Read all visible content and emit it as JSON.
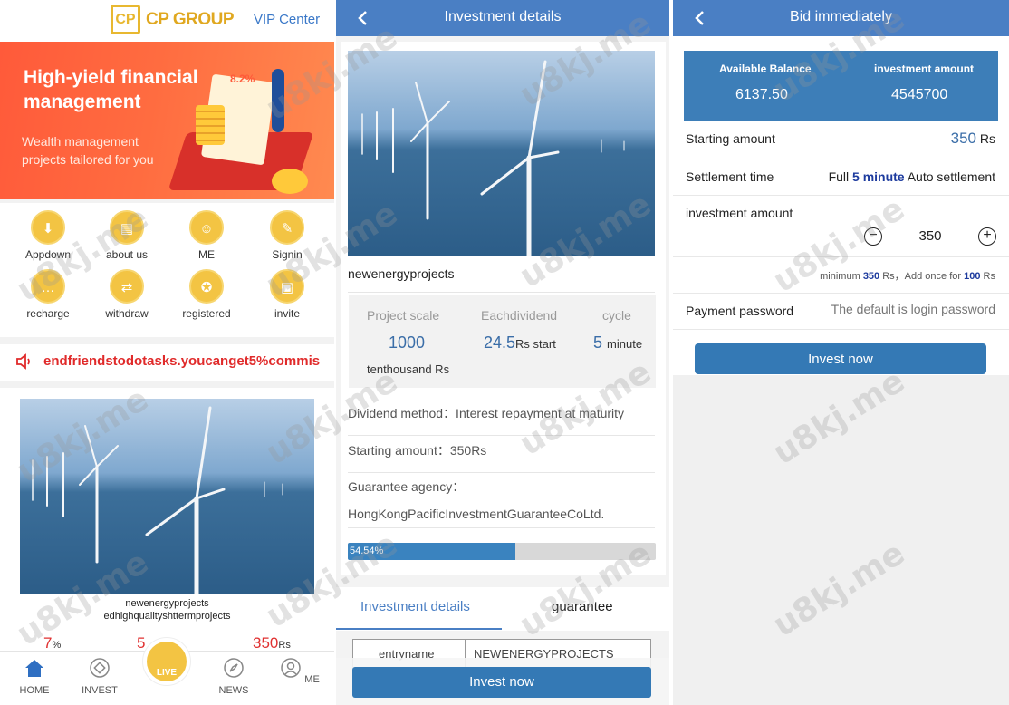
{
  "home": {
    "logo_icon": "CP",
    "logo_text": "CP GROUP",
    "vip_link": "VIP Center",
    "banner": {
      "title": "High-yield financial management",
      "subtitle": "Wealth management projects tailored for you",
      "art_text": "8.2%"
    },
    "icons": [
      {
        "label": "Appdown",
        "icon": "download-icon",
        "glyph": "⬇"
      },
      {
        "label": "about us",
        "icon": "document-icon",
        "glyph": "▤"
      },
      {
        "label": "ME",
        "icon": "users-icon",
        "glyph": "☺"
      },
      {
        "label": "Signin",
        "icon": "signin-icon",
        "glyph": "✎"
      },
      {
        "label": "recharge",
        "icon": "chat-icon",
        "glyph": "…"
      },
      {
        "label": "withdraw",
        "icon": "withdraw-icon",
        "glyph": "⇄"
      },
      {
        "label": "registered",
        "icon": "badge-icon",
        "glyph": "✪"
      },
      {
        "label": "invite",
        "icon": "wallet-icon",
        "glyph": "▣"
      }
    ],
    "marquee": "endfriendstodotasks.youcanget5%commis",
    "project": {
      "name": "newenergyprojects",
      "desc": "edhighqualityshttermprojects",
      "stat1_value": "7",
      "stat1_unit": "%",
      "stat2_value": "5",
      "stat3_value": "350",
      "stat3_unit": "Rs"
    },
    "tabs": {
      "home": "HOME",
      "invest": "INVEST",
      "live": "LIVE",
      "news": "NEWS",
      "me": "ME"
    }
  },
  "details": {
    "nav_title": "Investment details",
    "project_name": "newenergyprojects",
    "stats": {
      "scale_label": "Project scale",
      "dividend_label": "Eachdividend",
      "cycle_label": "cycle",
      "scale_value": "1000",
      "scale_unit": "tenthousand Rs",
      "dividend_value": "24.5",
      "dividend_unit": "Rs start",
      "cycle_value": "5",
      "cycle_unit": "minute"
    },
    "dividend_method": "Dividend method：Interest repayment at maturity",
    "starting_amount": "Starting amount：350Rs",
    "guarantee_label": "Guarantee agency：",
    "guarantee_value": "HongKongPacificInvestmentGuaranteeCoLtd.",
    "progress_text": "54.54%",
    "progress_value": 54.54,
    "tabs": {
      "details": "Investment details",
      "guarantee": "guarantee"
    },
    "table": {
      "key": "entryname",
      "value": "NEWENERGYPROJECTS"
    },
    "invest_button": "Invest now"
  },
  "bid": {
    "nav_title": "Bid immediately",
    "available_label": "Available Balance",
    "available_value": "6137.50",
    "investment_label": "investment amount",
    "investment_value": "4545700",
    "starting_label": "Starting amount",
    "starting_value": "350",
    "starting_unit": "Rs",
    "settlement_label": "Settlement time",
    "settlement_pre": "Full",
    "settlement_bold": "5 minute",
    "settlement_post": "Auto settlement",
    "amount_label": "investment amount",
    "amount_value": "350",
    "minimum_pre": "minimum",
    "minimum_value": "350",
    "minimum_mid": "Rs，Add once for",
    "step_value": "100",
    "step_unit": "Rs",
    "password_label": "Payment password",
    "password_placeholder": "The default is login password",
    "invest_button": "Invest now"
  },
  "watermark": "u8kj.me",
  "colors": {
    "accent": "#4a7fc4",
    "gold": "#f3c443",
    "red": "#e03030",
    "button": "#3479b5"
  }
}
